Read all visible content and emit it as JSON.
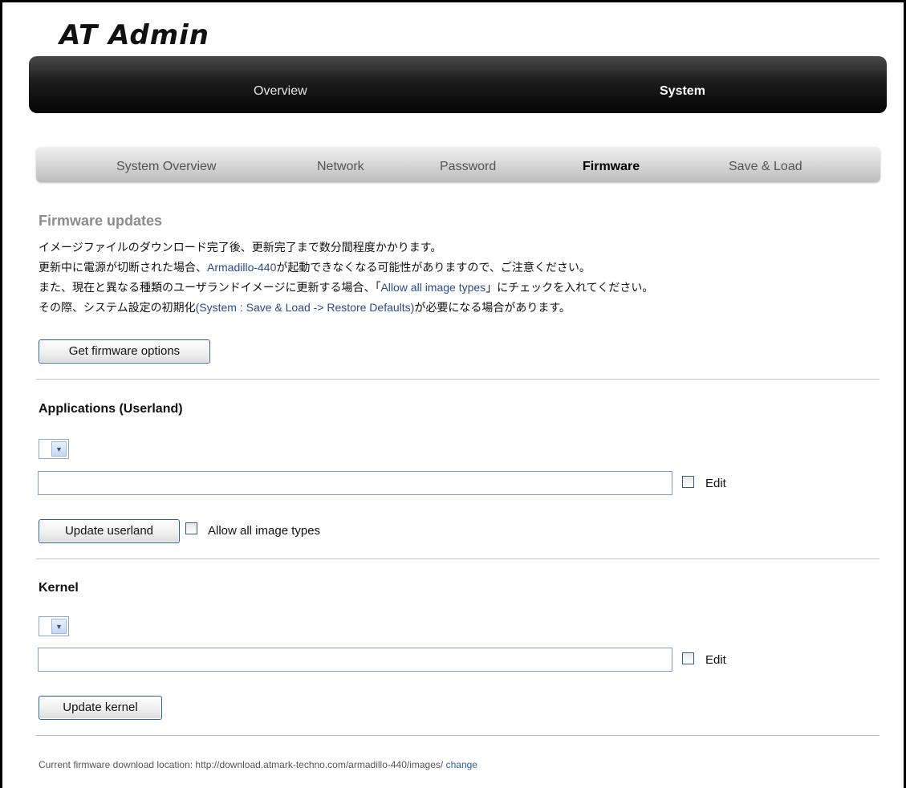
{
  "app": {
    "logo": "AT Admin"
  },
  "main_nav": [
    {
      "label": "Overview"
    },
    {
      "label": "System",
      "active": true
    }
  ],
  "sub_nav": [
    {
      "label": "System Overview"
    },
    {
      "label": "Network"
    },
    {
      "label": "Password"
    },
    {
      "label": "Firmware",
      "active": true
    },
    {
      "label": "Save & Load"
    }
  ],
  "firmware": {
    "title": "Firmware updates",
    "line1": "イメージファイルのダウンロード完了後、更新完了まで数分間程度かかります。",
    "line2_a": "更新中に電源が切断された場合、",
    "line2_link": "Armadillo-440",
    "line2_b": "が起動できなくなる可能性がありますので、ご注意ください。",
    "line3_a": "また、現在と異なる種類のユーザランドイメージに更新する場合、「",
    "line3_link": "Allow all image types",
    "line3_b": "」にチェックを入れてください。",
    "line4_a": "その際、システム設定の初期化",
    "line4_link": "(System : Save & Load -> Restore Defaults)",
    "line4_b": "が必要になる場合があります。",
    "get_options_button": "Get firmware options"
  },
  "userland": {
    "heading": "Applications (Userland)",
    "select_value": "",
    "url_value": "",
    "edit_label": "Edit",
    "edit_checked": false,
    "update_button": "Update userland",
    "allow_all_label": "Allow all image types",
    "allow_all_checked": false
  },
  "kernel": {
    "heading": "Kernel",
    "select_value": "",
    "url_value": "",
    "edit_label": "Edit",
    "edit_checked": false,
    "update_button": "Update kernel"
  },
  "footer": {
    "text": "Current firmware download location: http://download.atmark-techno.com/armadillo-440/images/",
    "change_link": "change"
  },
  "icons": {
    "dropdown_arrow": "chevron-down-icon"
  }
}
